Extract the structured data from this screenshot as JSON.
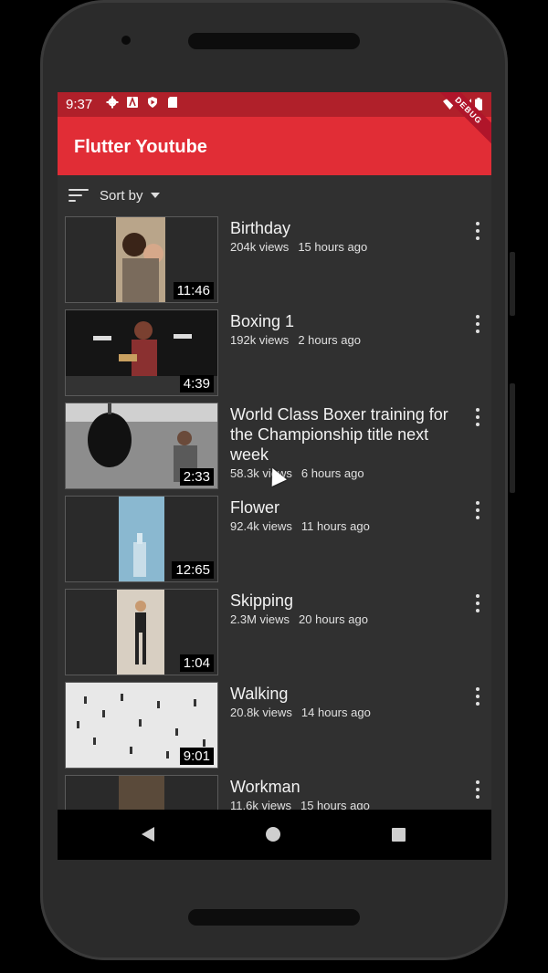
{
  "status_bar": {
    "time": "9:37",
    "icons": [
      "gear-icon",
      "a-icon",
      "shield-play-icon",
      "sdcard-icon"
    ],
    "right_icons": [
      "wifi-icon",
      "signal-icon",
      "battery-icon"
    ]
  },
  "app_bar": {
    "title": "Flutter Youtube",
    "debug_banner": "DEBUG"
  },
  "sort": {
    "label": "Sort by"
  },
  "videos": [
    {
      "title": "Birthday",
      "views": "204k views",
      "time": "15 hours ago",
      "duration": "11:46"
    },
    {
      "title": "Boxing 1",
      "views": "192k views",
      "time": "2 hours ago",
      "duration": "4:39"
    },
    {
      "title": "World Class Boxer training for the Championship title next week",
      "views": "58.3k views",
      "time": "6 hours ago",
      "duration": "2:33"
    },
    {
      "title": "Flower",
      "views": "92.4k views",
      "time": "11 hours ago",
      "duration": "12:65"
    },
    {
      "title": "Skipping",
      "views": "2.3M views",
      "time": "20 hours ago",
      "duration": "1:04"
    },
    {
      "title": "Walking",
      "views": "20.8k views",
      "time": "14 hours ago",
      "duration": "9:01"
    },
    {
      "title": "Workman",
      "views": "11.6k views",
      "time": "15 hours ago",
      "duration": ""
    }
  ],
  "colors": {
    "app_bar": "#e12d36",
    "status_bar": "#b0202a",
    "background": "#303030"
  }
}
